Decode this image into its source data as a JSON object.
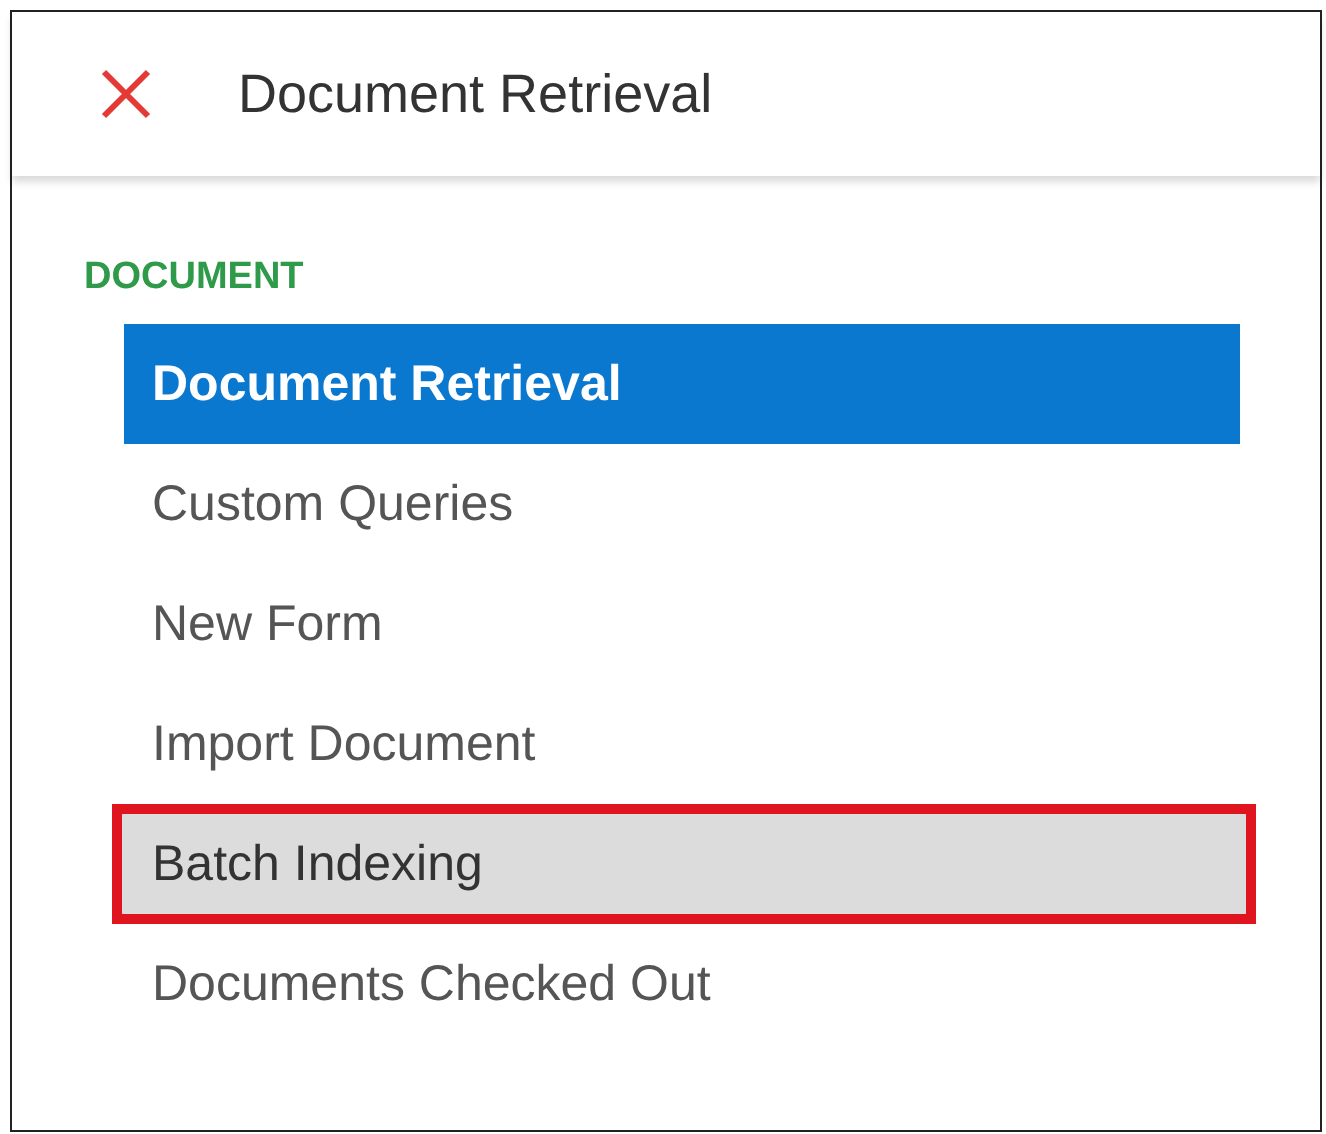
{
  "header": {
    "title": "Document Retrieval"
  },
  "section": {
    "label": "DOCUMENT"
  },
  "items": [
    {
      "label": "Document Retrieval",
      "selected": true,
      "highlighted": false
    },
    {
      "label": "Custom Queries",
      "selected": false,
      "highlighted": false
    },
    {
      "label": "New Form",
      "selected": false,
      "highlighted": false
    },
    {
      "label": "Import Document",
      "selected": false,
      "highlighted": false
    },
    {
      "label": "Batch Indexing",
      "selected": false,
      "highlighted": true
    },
    {
      "label": "Documents Checked Out",
      "selected": false,
      "highlighted": false
    }
  ]
}
